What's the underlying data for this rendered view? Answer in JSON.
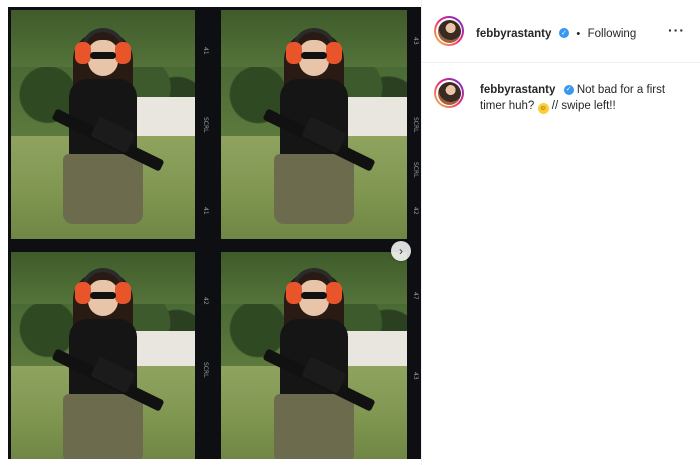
{
  "post": {
    "username": "febbyrastanty",
    "follow_status": "Following",
    "separator": "•",
    "more_icon": "more-horizontal-icon",
    "verified_icon": "verified-badge-icon",
    "caption_username": "febbyrastanty",
    "caption_part1": "Not bad for a first timer huh?",
    "caption_emoji": "grinning-sweat-emoji",
    "caption_part2": "// swipe left!!",
    "next_icon": "chevron-right-icon"
  },
  "film": {
    "markers": [
      "41",
      "SCRL",
      "41",
      "SCRL",
      "42",
      "SCRL",
      "43",
      "42",
      "SCRL",
      "43",
      "47",
      "SCRL",
      "43",
      "SCRL"
    ]
  },
  "colors": {
    "verified": "#3897f0",
    "avatar_ring_start": "#f9ce34",
    "avatar_ring_mid": "#ee2a7b",
    "avatar_ring_end": "#6228d7",
    "film_border": "#0d0f12"
  }
}
